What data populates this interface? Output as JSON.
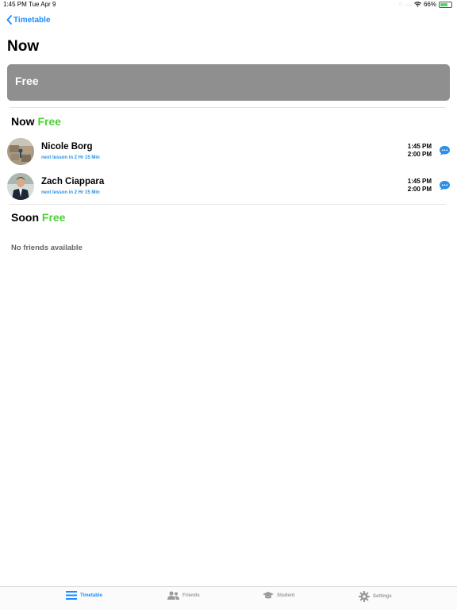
{
  "status_bar": {
    "time": "1:45 PM",
    "date": "Tue Apr 9",
    "signal": ".....",
    "battery_text": "66%",
    "battery_level": 0.66
  },
  "nav": {
    "back_label": "Timetable"
  },
  "page": {
    "title": "Now"
  },
  "banner": {
    "label": "Free"
  },
  "now_section": {
    "prefix": "Now",
    "status": "Free"
  },
  "friends": [
    {
      "name": "Nicole Borg",
      "next_lesson": "next lesson in 2 Hr 15 Min",
      "start": "1:45 PM",
      "end": "2:00 PM"
    },
    {
      "name": "Zach Ciappara",
      "next_lesson": "next lesson in 2 Hr 15 Min",
      "start": "1:45 PM",
      "end": "2:00 PM"
    }
  ],
  "soon_section": {
    "prefix": "Soon",
    "status": "Free",
    "empty_message": "No friends available"
  },
  "tab_bar": {
    "tabs": [
      {
        "label": "Timetable",
        "icon": "list-icon",
        "active": true
      },
      {
        "label": "Friends",
        "icon": "people-icon",
        "active": false
      },
      {
        "label": "Student",
        "icon": "graduation-cap-icon",
        "active": false
      },
      {
        "label": "Settings",
        "icon": "gear-icon",
        "active": false
      }
    ]
  },
  "colors": {
    "accent": "#1a8cff",
    "free_green": "#4cd137",
    "banner_gray": "#8f8f8f"
  }
}
